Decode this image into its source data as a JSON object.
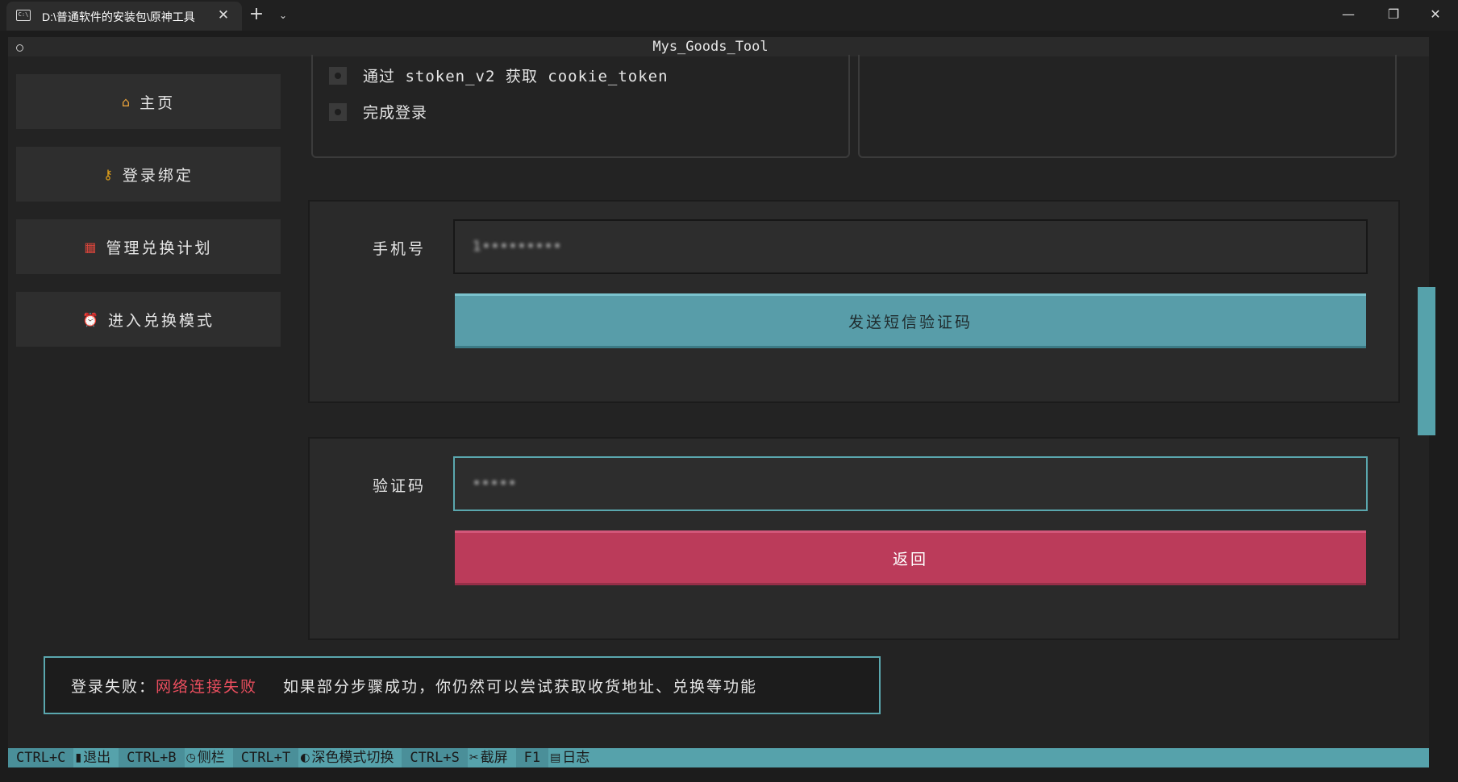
{
  "window": {
    "tab_title": "D:\\普通软件的安装包\\原神工具",
    "tab_close": "✕",
    "new_tab": "+",
    "dropdown": "⌄",
    "minimize": "—",
    "maximize": "❐",
    "close": "✕"
  },
  "app": {
    "title": "Mys_Goods_Tool"
  },
  "sidebar": {
    "items": [
      {
        "label": "主页",
        "icon": "home-icon"
      },
      {
        "label": "登录绑定",
        "icon": "key-icon"
      },
      {
        "label": "管理兑换计划",
        "icon": "calendar-icon"
      },
      {
        "label": "进入兑换模式",
        "icon": "alarm-clock-icon"
      }
    ]
  },
  "steps": {
    "items": [
      {
        "label": "通过 stoken_v2 获取 cookie_token"
      },
      {
        "label": "完成登录"
      }
    ]
  },
  "phone_section": {
    "label": "手机号",
    "value": "1•••••••••",
    "button": "发送短信验证码"
  },
  "code_section": {
    "label": "验证码",
    "value": "•••••",
    "button": "返回"
  },
  "notice": {
    "prefix": "登录失败：",
    "error": "网络连接失败",
    "message": "如果部分步骤成功，你仍然可以尝试获取收货地址、兑换等功能"
  },
  "footer": {
    "items": [
      {
        "key": "CTRL+C",
        "label": "退出",
        "icon": "door-icon"
      },
      {
        "key": "CTRL+B",
        "label": "侧栏",
        "icon": "clock-icon"
      },
      {
        "key": "CTRL+T",
        "label": "深色模式切换",
        "icon": "moon-icon"
      },
      {
        "key": "CTRL+S",
        "label": "截屏",
        "icon": "scissors-icon"
      },
      {
        "key": "F1",
        "label": "日志",
        "icon": "notepad-icon"
      }
    ]
  },
  "colors": {
    "accent": "#56a2ab",
    "danger": "#bb3b5a",
    "error_text": "#ea4e5e"
  }
}
